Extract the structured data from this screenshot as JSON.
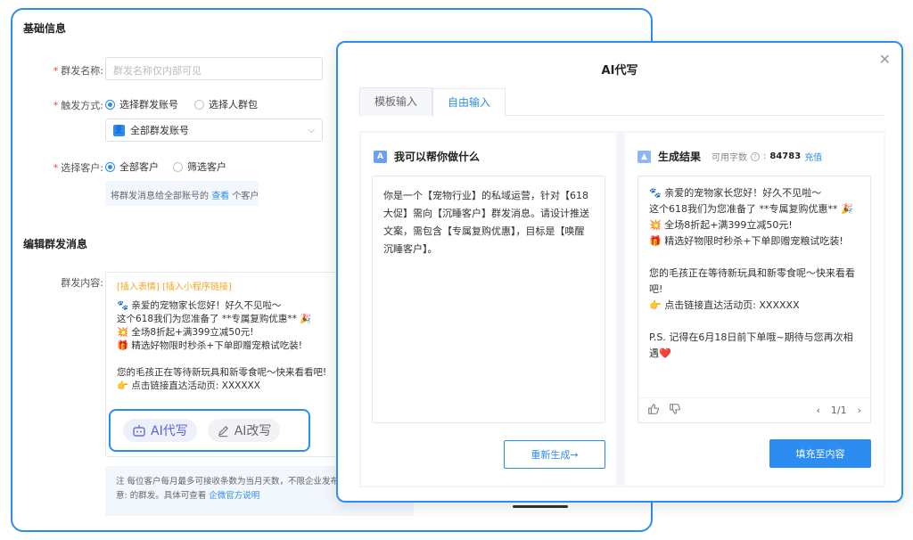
{
  "form": {
    "basic_title": "基础信息",
    "name_label": "群发名称:",
    "name_placeholder": "群发名称仅内部可见",
    "trigger_label": "触发方式:",
    "trigger_opt1": "选择群发账号",
    "trigger_opt2": "选择人群包",
    "account_select": "全部群发账号",
    "customer_label": "选择客户:",
    "customer_opt1": "全部客户",
    "customer_opt2": "筛选客户",
    "hint_pre": "将群发消息给全部账号的",
    "hint_link": "查看",
    "hint_post": "个客户",
    "edit_title": "编辑群发消息",
    "content_label": "群发内容:",
    "insert_links": "[插入表情] [插入小程序链接]",
    "message": "🐾 亲爱的宠物家长您好！好久不见啦～\n这个618我们为您准备了 **专属复购优惠** 🎉\n💥 全场8折起+满399立减50元!\n🎁 精选好物限时秒杀+下单即赠宠粮试吃装!\n\n您的毛孩正在等待新玩具和新零食呢～快来看看吧!\n👉 点击链接直达活动页: XXXXXX",
    "ai_write": "AI代写",
    "ai_rewrite": "AI改写",
    "note_line1": "注    每位客户每月最多可接收条数为当月天数，不限企业发布的",
    "note_line2_pre": "意:    的群发。具体可查看",
    "note_link": "企微官方说明"
  },
  "modal": {
    "title": "AI代写",
    "tabs": [
      "模板输入",
      "自由输入"
    ],
    "left_head": "我可以帮你做什么",
    "prompt": "你是一个【宠物行业】的私域运营，针对【618大促】需向【沉睡客户】群发消息。请设计推送文案，需包含【专属复购优惠】，目标是【唤醒沉睡客户】。",
    "regen": "重新生成→",
    "right_head": "生成结果",
    "available_label": "可用字数",
    "available_num": "84783",
    "recharge": "充值",
    "result": "🐾 亲爱的宠物家长您好！好久不见啦～\n这个618我们为您准备了 **专属复购优惠** 🎉\n💥 全场8折起+满399立减50元!\n🎁 精选好物限时秒杀+下单即赠宠粮试吃装!\n\n您的毛孩正在等待新玩具和新零食呢～快来看看\n吧!\n👉 点击链接直达活动页: XXXXXX\n\nP.S. 记得在6月18日前下单哦~期待与您再次相\n遇❤️",
    "pager": "1/1",
    "fill": "填充至内容"
  }
}
